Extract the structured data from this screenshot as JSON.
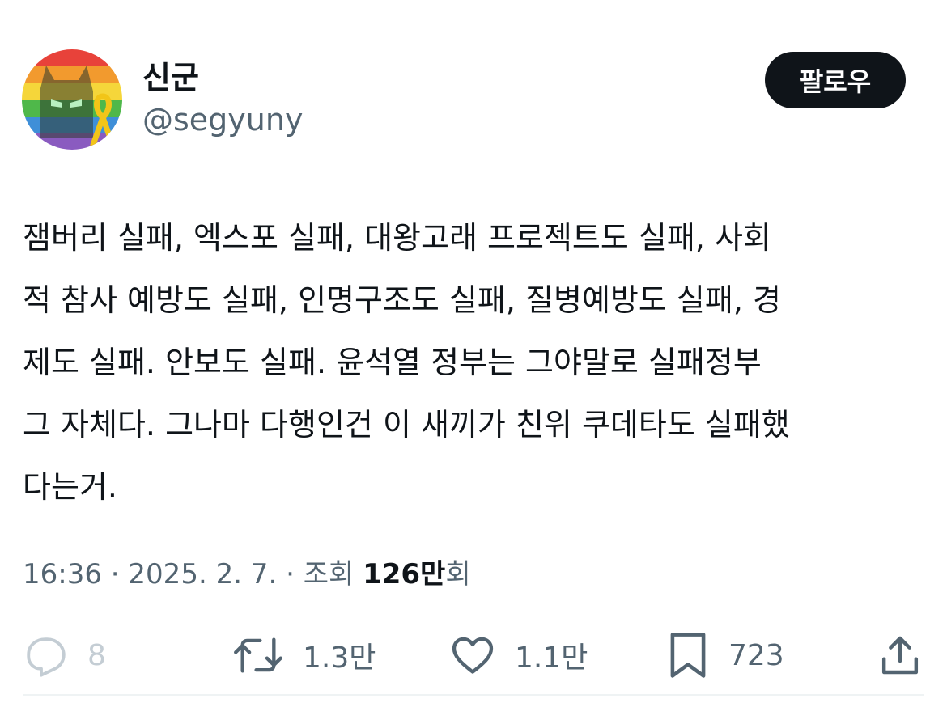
{
  "author": {
    "display_name": "신군",
    "handle": "@segyuny"
  },
  "follow_button": {
    "label": "팔로우"
  },
  "tweet": {
    "lines": [
      "잼버리 실패, 엑스포 실패, 대왕고래 프로젝트도 실패, 사회",
      "적 참사 예방도 실패, 인명구조도 실패, 질병예방도 실패, 경",
      "제도 실패. 안보도 실패. 윤석열 정부는 그야말로 실패정부",
      "그 자체다. 그나마 다행인건 이 새끼가 친위 쿠데타도 실패했",
      "다는거."
    ]
  },
  "meta": {
    "time": "16:36",
    "separator": " · ",
    "date": "2025. 2. 7.",
    "views_label": "조회",
    "views_count": "126만",
    "views_suffix": "회"
  },
  "actions": {
    "reply": {
      "icon": "reply-icon",
      "count": "8"
    },
    "retweet": {
      "icon": "retweet-icon",
      "count": "1.3만"
    },
    "like": {
      "icon": "heart-icon",
      "count": "1.1만"
    },
    "bookmark": {
      "icon": "bookmark-icon",
      "count": "723"
    },
    "share": {
      "icon": "share-icon"
    }
  },
  "colors": {
    "text": "#0f1419",
    "secondary": "#536471",
    "button_bg": "#0f1419",
    "divider": "#eff3f4"
  }
}
